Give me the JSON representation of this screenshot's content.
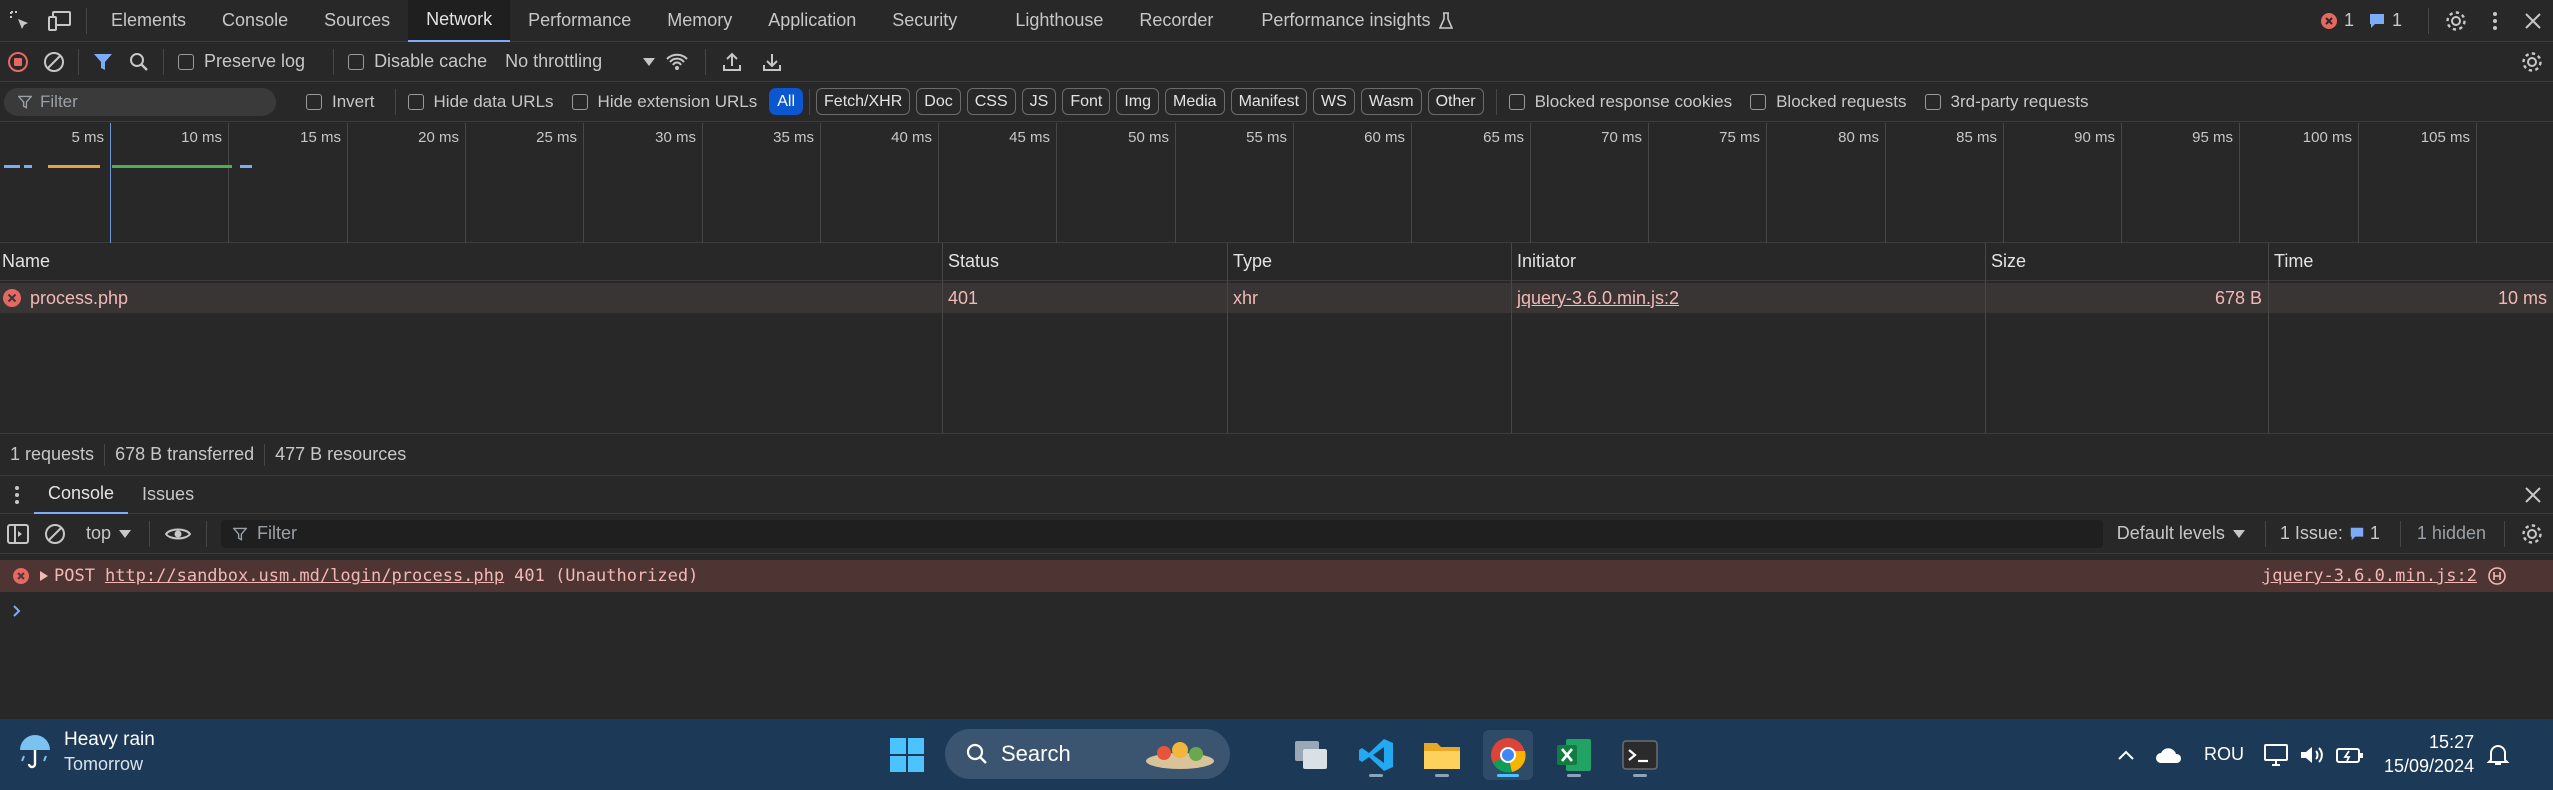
{
  "devtools": {
    "tabs": [
      "Elements",
      "Console",
      "Sources",
      "Network",
      "Performance",
      "Memory",
      "Application",
      "Security",
      "Lighthouse",
      "Recorder",
      "Performance insights"
    ],
    "active_tab": "Network",
    "errors_count": "1",
    "messages_count": "1"
  },
  "network_toolbar": {
    "preserve_log": "Preserve log",
    "disable_cache": "Disable cache",
    "throttling": "No throttling"
  },
  "filter_row": {
    "filter_placeholder": "Filter",
    "invert": "Invert",
    "hide_data_urls": "Hide data URLs",
    "hide_extension_urls": "Hide extension URLs",
    "types": [
      "All",
      "Fetch/XHR",
      "Doc",
      "CSS",
      "JS",
      "Font",
      "Img",
      "Media",
      "Manifest",
      "WS",
      "Wasm",
      "Other"
    ],
    "active_type": "All",
    "blocked_cookies": "Blocked response cookies",
    "blocked_requests": "Blocked requests",
    "third_party": "3rd-party requests"
  },
  "timeline": {
    "ticks": [
      "5 ms",
      "10 ms",
      "15 ms",
      "20 ms",
      "25 ms",
      "30 ms",
      "35 ms",
      "40 ms",
      "45 ms",
      "50 ms",
      "55 ms",
      "60 ms",
      "65 ms",
      "70 ms",
      "75 ms",
      "80 ms",
      "85 ms",
      "90 ms",
      "95 ms",
      "100 ms",
      "105 ms"
    ]
  },
  "table": {
    "headers": [
      "Name",
      "Status",
      "Type",
      "Initiator",
      "Size",
      "Time"
    ],
    "rows": [
      {
        "name": "process.php",
        "status": "401",
        "type": "xhr",
        "initiator": "jquery-3.6.0.min.js:2",
        "size": "678 B",
        "time": "10 ms"
      }
    ]
  },
  "summary": {
    "requests": "1 requests",
    "transferred": "678 B transferred",
    "resources": "477 B resources"
  },
  "drawer": {
    "tabs": [
      "Console",
      "Issues"
    ],
    "active_tab": "Console",
    "context": "top",
    "filter_placeholder": "Filter",
    "levels": "Default levels",
    "issues_label": "1 Issue:",
    "issues_count": "1",
    "hidden": "1 hidden",
    "error": {
      "method": "POST",
      "url": "http://sandbox.usm.md/login/process.php",
      "status_text": "401 (Unauthorized)",
      "source": "jquery-3.6.0.min.js:2"
    }
  },
  "taskbar": {
    "weather_title": "Heavy rain",
    "weather_sub": "Tomorrow",
    "search_label": "Search",
    "language": "ROU",
    "time": "15:27",
    "date": "15/09/2024"
  },
  "colors": {
    "error_red": "#e46962",
    "accent_blue": "#7cacf8",
    "taskbar": "#1c3a57"
  }
}
